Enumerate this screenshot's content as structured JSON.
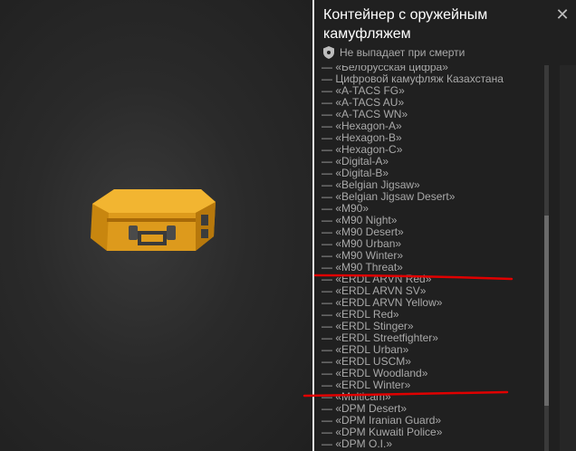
{
  "header": {
    "title": "Контейнер с оружейным камуфляжем",
    "subtitle": "Не выпадает при смерти",
    "close_icon": "close-icon",
    "shield_icon": "shield-icon"
  },
  "colors": {
    "case": "#e8a520",
    "annotation": "#e00000",
    "divider": "#e9e9e9"
  },
  "camo_list": [
    "— «Белорусская цифра»",
    "— Цифровой камуфляж Казахстана",
    "— «A-TACS FG»",
    "— «A-TACS AU»",
    "— «A-TACS WN»",
    "— «Hexagon-A»",
    "— «Hexagon-B»",
    "— «Hexagon-C»",
    "— «Digital-A»",
    "— «Digital-B»",
    "— «Belgian Jigsaw»",
    "— «Belgian Jigsaw Desert»",
    "— «M90»",
    "— «M90 Night»",
    "— «M90 Desert»",
    "— «M90 Urban»",
    "— «M90 Winter»",
    "— «M90 Threat»",
    "— «ERDL ARVN Red»",
    "— «ERDL ARVN SV»",
    "— «ERDL ARVN Yellow»",
    "— «ERDL Red»",
    "— «ERDL Stinger»",
    "— «ERDL Streetfighter»",
    "— «ERDL Urban»",
    "— «ERDL USCM»",
    "— «ERDL Woodland»",
    "— «ERDL Winter»",
    "— «Multicam»",
    "— «DPM Desert»",
    "— «DPM Iranian Guard»",
    "— «DPM Kuwaiti Police»",
    "— «DPM O.I.»"
  ]
}
